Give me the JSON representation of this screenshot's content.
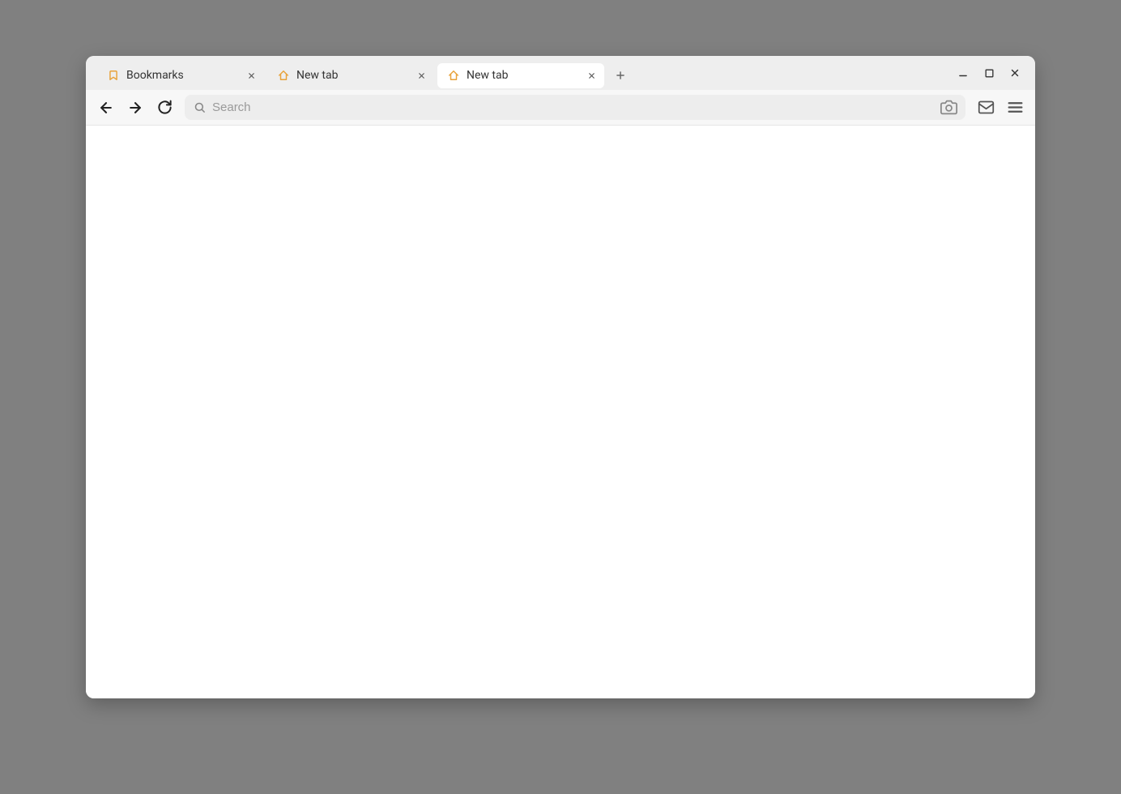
{
  "tabs": [
    {
      "label": "Bookmarks",
      "icon": "bookmark",
      "active": false
    },
    {
      "label": "New tab",
      "icon": "home",
      "active": false
    },
    {
      "label": "New tab",
      "icon": "home",
      "active": true
    }
  ],
  "search": {
    "placeholder": "Search",
    "value": ""
  },
  "colors": {
    "accent": "#e8a23a"
  }
}
